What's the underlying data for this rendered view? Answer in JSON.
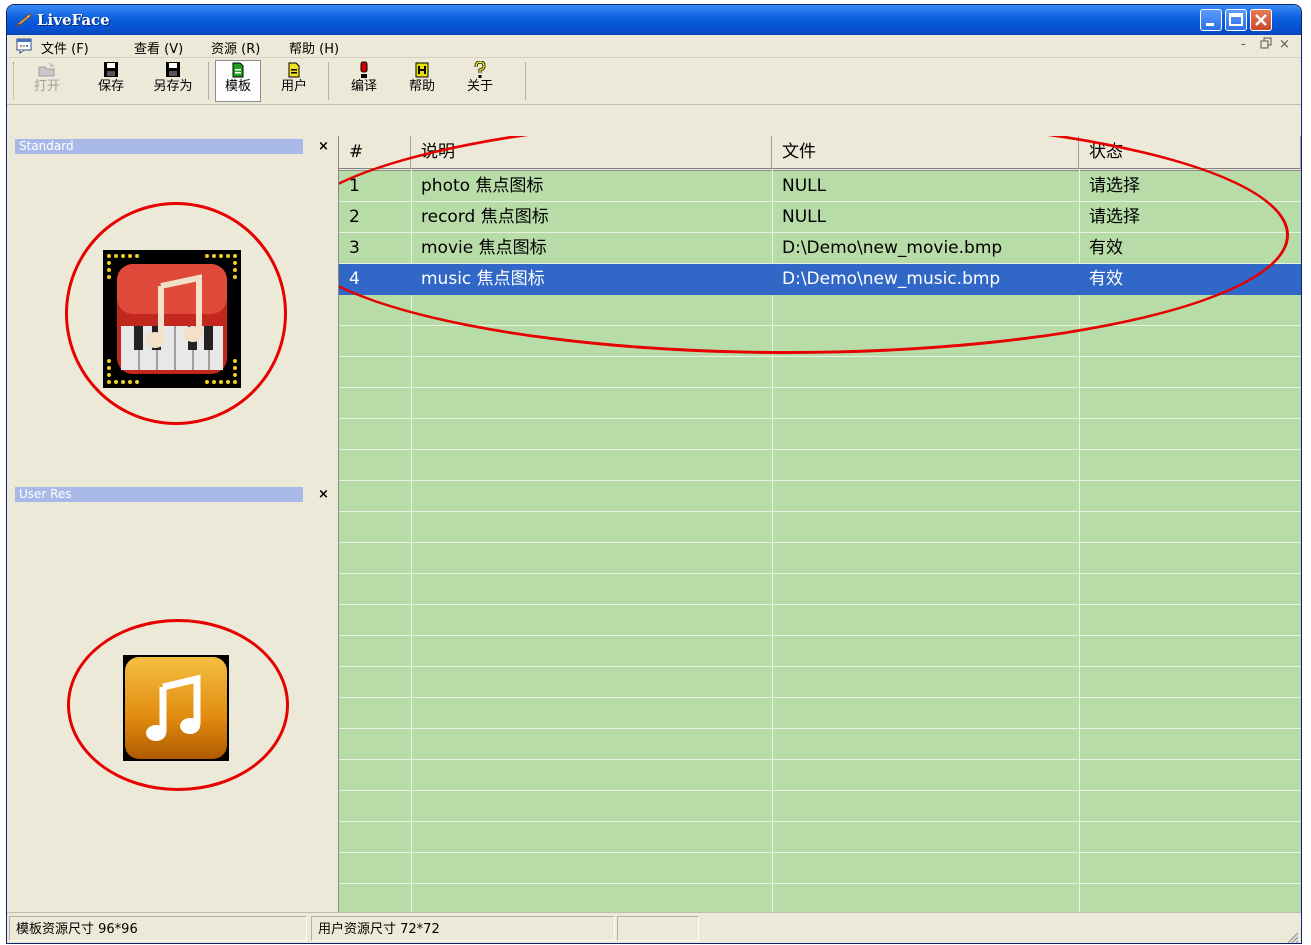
{
  "window": {
    "title": "LiveFace"
  },
  "menu": [
    {
      "label": "文件 (F)"
    },
    {
      "label": "查看 (V)"
    },
    {
      "label": "资源 (R)"
    },
    {
      "label": "帮助 (H)"
    }
  ],
  "mdi_controls": {
    "minimize": "-",
    "restore": "ㅁ",
    "close": "×"
  },
  "toolbar": [
    {
      "label": "打开",
      "icon": "open-folder-icon",
      "enabled": false
    },
    {
      "label": "保存",
      "icon": "save-disk-icon",
      "enabled": true
    },
    {
      "label": "另存为",
      "icon": "save-as-disk-icon",
      "enabled": true
    },
    {
      "label": "模板",
      "icon": "template-doc-icon",
      "enabled": true,
      "pressed": true
    },
    {
      "label": "用户",
      "icon": "user-doc-icon",
      "enabled": true
    },
    {
      "label": "编译",
      "icon": "compile-exclamation-icon",
      "enabled": true
    },
    {
      "label": "帮助",
      "icon": "help-book-icon",
      "enabled": true
    },
    {
      "label": "关于",
      "icon": "about-question-icon",
      "enabled": true
    }
  ],
  "panes": {
    "standard": {
      "title": "Standard",
      "close": "×",
      "preview_icon": "piano-music-icon"
    },
    "user_res": {
      "title": "User Res",
      "close": "×",
      "preview_icon": "music-note-icon"
    }
  },
  "grid": {
    "columns": [
      "#",
      "说明",
      "文件",
      "状态"
    ],
    "rows": [
      {
        "num": "1",
        "desc": "photo 焦点图标",
        "file": "NULL",
        "status": "请选择",
        "selected": false
      },
      {
        "num": "2",
        "desc": "record 焦点图标",
        "file": "NULL",
        "status": "请选择",
        "selected": false
      },
      {
        "num": "3",
        "desc": "movie 焦点图标",
        "file": "D:\\Demo\\new_movie.bmp",
        "status": "有效",
        "selected": false
      },
      {
        "num": "4",
        "desc": "music 焦点图标",
        "file": "D:\\Demo\\new_music.bmp",
        "status": "有效",
        "selected": true
      }
    ]
  },
  "status": {
    "template_size": "模板资源尺寸 96*96",
    "user_size": "用户资源尺寸 72*72"
  },
  "colors": {
    "grid_bg": "#b8dca8",
    "selection": "#3167c7",
    "annotation": "#e60000",
    "title_bar": "#0a5fdc"
  }
}
